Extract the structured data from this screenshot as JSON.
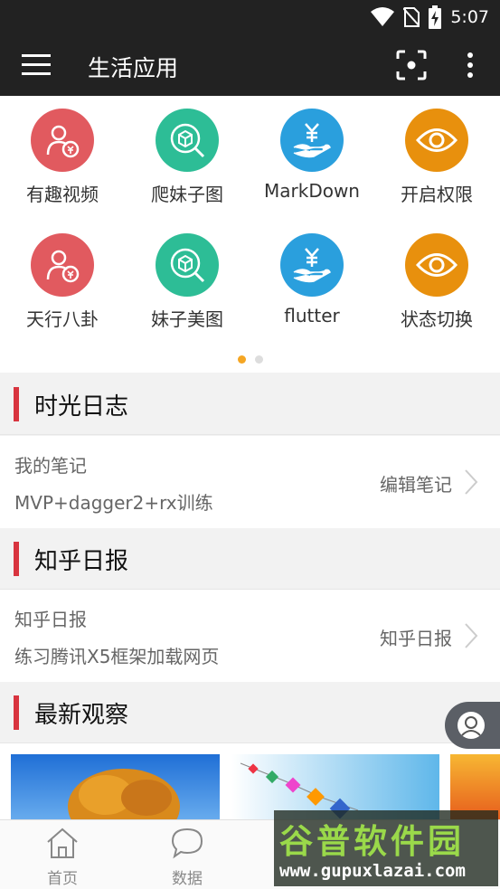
{
  "status_bar": {
    "time": "5:07"
  },
  "app_bar": {
    "title": "生活应用"
  },
  "grid": [
    {
      "label": "有趣视频",
      "icon": "money-person-icon",
      "color": "#e15a5f"
    },
    {
      "label": "爬妹子图",
      "icon": "box-search-icon",
      "color": "#2dbd96"
    },
    {
      "label": "MarkDown",
      "icon": "yen-hand-icon",
      "color": "#2a9fdd"
    },
    {
      "label": "开启权限",
      "icon": "eye-icon",
      "color": "#e8900d"
    },
    {
      "label": "天行八卦",
      "icon": "money-person-icon",
      "color": "#e15a5f"
    },
    {
      "label": "妹子美图",
      "icon": "box-search-icon",
      "color": "#2dbd96"
    },
    {
      "label": "flutter",
      "icon": "yen-hand-icon",
      "color": "#2a9fdd"
    },
    {
      "label": "状态切换",
      "icon": "eye-icon",
      "color": "#e8900d"
    }
  ],
  "sections": {
    "diary": {
      "title": "时光日志",
      "card": {
        "line1": "我的笔记",
        "line2": "MVP+dagger2+rx训练",
        "action": "编辑笔记"
      }
    },
    "zhihu": {
      "title": "知乎日报",
      "card": {
        "line1": "知乎日报",
        "line2": "练习腾讯X5框架加载网页",
        "action": "知乎日报"
      }
    },
    "latest": {
      "title": "最新观察"
    }
  },
  "bottom_nav": [
    {
      "label": "首页",
      "icon": "home-icon"
    },
    {
      "label": "数据",
      "icon": "chat-bubble-icon"
    }
  ],
  "watermark": {
    "title": "谷普软件园",
    "url": "www.gupuxlazai.com"
  },
  "colors": {
    "accent_bar": "#d8343f",
    "dot_active": "#f5a623",
    "appbar": "#222222"
  }
}
